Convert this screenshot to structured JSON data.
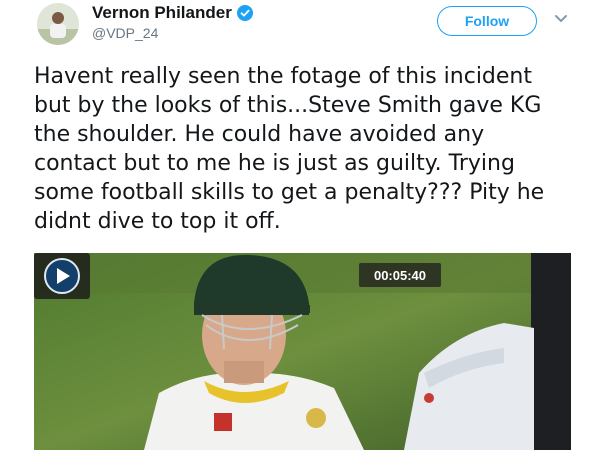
{
  "header": {
    "display_name": "Vernon Philander",
    "handle": "@VDP_24",
    "follow_label": "Follow"
  },
  "tweet": {
    "text": "Havent really seen the fotage of this incident\nbut by the looks of this...Steve Smith gave KG\nthe shoulder. He could have avoided any\ncontact but to me he is just as guilty. Trying\nsome football skills to get a penalty??? Pity he\ndidnt dive to top it off."
  },
  "media": {
    "timestamp": "00:05:40"
  },
  "icons": [
    "verified-badge-icon",
    "chevron-down-icon",
    "play-icon"
  ],
  "colors": {
    "accent": "#1da1f2",
    "text": "#14171a",
    "secondary": "#657786"
  }
}
